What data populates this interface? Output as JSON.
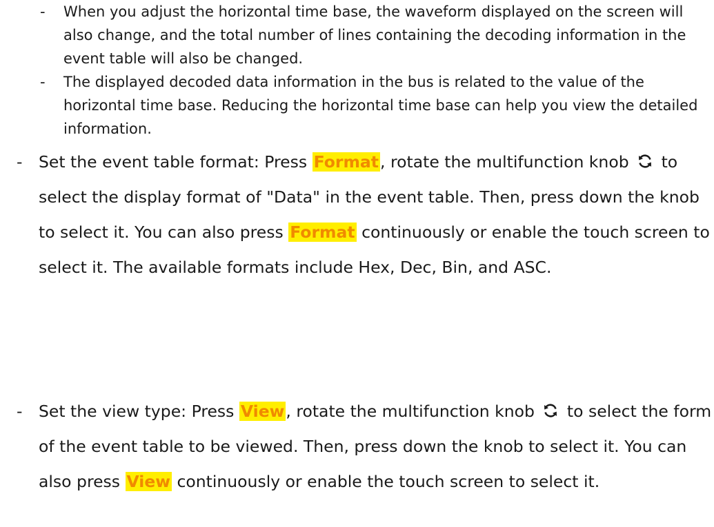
{
  "sub_bullets": [
    {
      "dash": "-",
      "text": "When you adjust the horizontal time base, the waveform displayed on the screen will also change, and the total number of lines containing the decoding information in the event table will also be changed."
    },
    {
      "dash": "-",
      "text": "The displayed decoded data information in the bus is related to the value of the horizontal time base. Reducing the horizontal time base can help you view the detailed information."
    }
  ],
  "format_bullet": {
    "dash": "-",
    "p1": "Set the event table format: Press ",
    "kw1": "Format",
    "p2": ", rotate the multifunction knob ",
    "icon": "rotate-knob-icon",
    "p3": " to select the display format of \"Data\" in the event table. Then, press down the knob to select it. You can also press ",
    "kw2": "Format",
    "p4": " continuously or enable the touch screen to select it. The available formats include Hex, Dec, Bin, and ASC."
  },
  "view_bullet": {
    "dash": "-",
    "p1": "Set the view type: Press ",
    "kw1": "View",
    "p2": ", rotate the multifunction knob ",
    "icon": "rotate-knob-icon",
    "p3": " to select the form of the event table to be viewed. Then, press down the knob to select it. You can also press ",
    "kw2": "View",
    "p4": " continuously or enable the touch screen to select it."
  },
  "colors": {
    "highlight_bg": "#ffee00",
    "highlight_text": "#f08a00",
    "body_text": "#1a1a1a"
  }
}
